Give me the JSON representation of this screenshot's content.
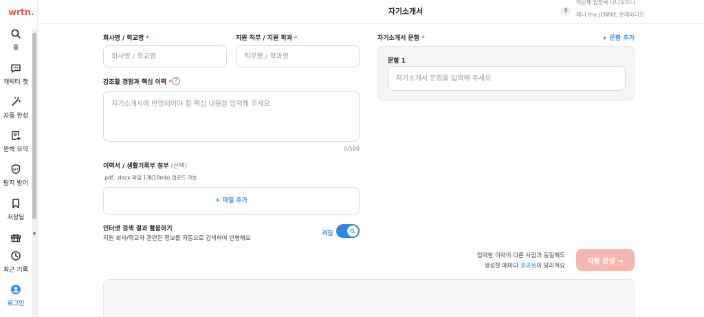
{
  "sidebar": {
    "logo": "wrtn.",
    "items": [
      {
        "label": "홈",
        "icon": "search-icon"
      },
      {
        "label": "캐릭터 챗",
        "icon": "chat-bubble-icon"
      },
      {
        "label": "자동 완성",
        "icon": "magic-wand-icon"
      },
      {
        "label": "완벽 요약",
        "icon": "summary-icon"
      },
      {
        "label": "탐지 방어",
        "icon": "shield-icon"
      },
      {
        "label": "저장됨",
        "icon": "bookmark-icon"
      },
      {
        "label": "",
        "icon": "gift-icon"
      },
      {
        "label": "최근 기록",
        "icon": "clock-icon"
      },
      {
        "label": "로그인",
        "icon": "user-icon"
      }
    ]
  },
  "header": {
    "title": "자기소개서",
    "notification": {
      "badge": "9",
      "line1": "이문제 입장록 나나오드니",
      "line2": "제니 the JENNIE 문재비디오"
    }
  },
  "form": {
    "company": {
      "label": "회사명 / 학교명",
      "required": "*",
      "placeholder": "회사명 / 학교명"
    },
    "position": {
      "label": "지원 직무 / 지원 학과",
      "required": "*",
      "placeholder": "직무명 / 학과명"
    },
    "experience": {
      "label": "강조할 경험과 핵심 이력",
      "required": "*",
      "help": "?",
      "placeholder": "자기소개서에 반영되어야 할 핵심 내용을 입력해 주세요",
      "counter": "0/500"
    },
    "attachment": {
      "label": "이력서 / 생활기록부 첨부",
      "optional": "(선택)",
      "note": ".pdf, .docx 파일 1개(10mb) 업로드 가능",
      "button": "+ 파일 추가"
    },
    "internet_search": {
      "title": "인터넷 검색 결과 활용하기",
      "description": "지원 회사/학교와 관련된 정보를 자동으로 검색하여 반영해요",
      "state": "켜짐",
      "enabled": true
    }
  },
  "questions": {
    "label": "자기소개서 문항",
    "required": "*",
    "add_button": "+ 문항 추가",
    "items": [
      {
        "title": "문항 1",
        "placeholder": "자기소개서 문항을 입력해 주세요"
      }
    ]
  },
  "submit": {
    "note_line1": "입력한 이력이 다른 사람과 동일해도",
    "note_line2_prefix": "생성할 때마다 ",
    "note_line2_link": "결과물",
    "note_line2_suffix": "이 달라져요",
    "button": "자동 완성 →"
  },
  "colors": {
    "brand": "#f2554a",
    "accent_blue": "#3b8fe6",
    "toggle_on": "#2d86e3",
    "submit_disabled": "#f8b7ae",
    "panel_bg": "#f5f5f5"
  }
}
